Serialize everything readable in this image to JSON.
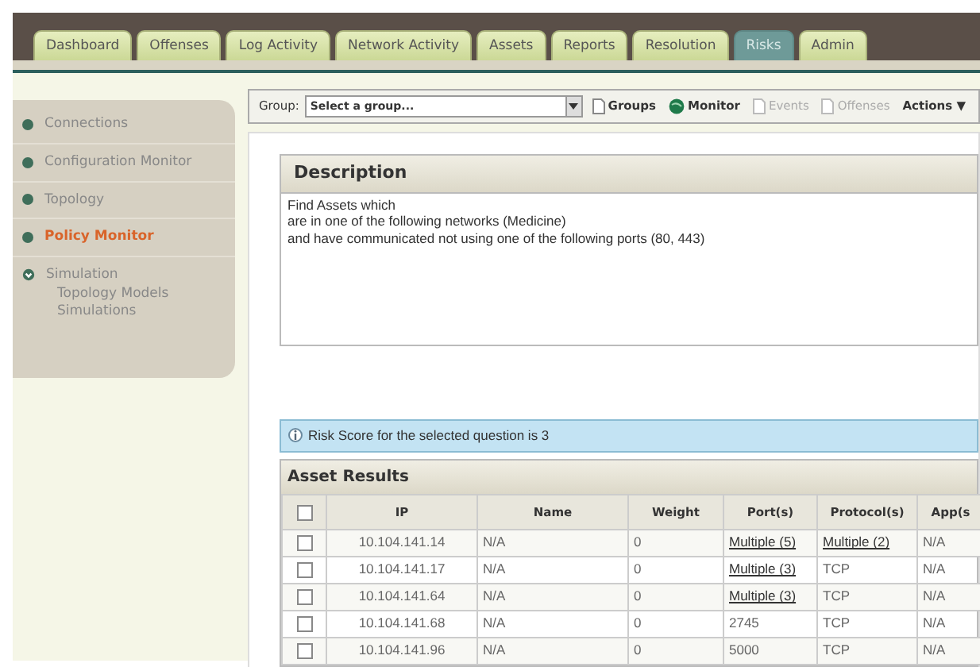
{
  "tabs": [
    {
      "label": "Dashboard",
      "selected": false
    },
    {
      "label": "Offenses",
      "selected": false
    },
    {
      "label": "Log Activity",
      "selected": false
    },
    {
      "label": "Network Activity",
      "selected": false
    },
    {
      "label": "Assets",
      "selected": false
    },
    {
      "label": "Reports",
      "selected": false
    },
    {
      "label": "Resolution",
      "selected": false
    },
    {
      "label": "Risks",
      "selected": true
    },
    {
      "label": "Admin",
      "selected": false
    }
  ],
  "sidebar": {
    "items": [
      {
        "kind": "bullet",
        "label": "Connections",
        "selected": false
      },
      {
        "kind": "bullet",
        "label": "Configuration Monitor",
        "selected": false
      },
      {
        "kind": "bullet",
        "label": "Topology",
        "selected": false
      },
      {
        "kind": "bullet",
        "label": "Policy Monitor",
        "selected": true
      },
      {
        "kind": "group",
        "label": "Simulation",
        "selected": false,
        "children": [
          {
            "label": "Topology Models"
          },
          {
            "label": "Simulations"
          }
        ]
      }
    ]
  },
  "toolbar": {
    "group_label": "Group:",
    "group_select": "Select a group...",
    "buttons": [
      {
        "kind": "page",
        "label": "Groups",
        "disabled": false
      },
      {
        "kind": "monitor",
        "label": "Monitor",
        "disabled": false
      },
      {
        "kind": "page",
        "label": "Events",
        "disabled": true
      },
      {
        "kind": "page",
        "label": "Offenses",
        "disabled": true
      },
      {
        "kind": "menu",
        "label": "Actions",
        "caret": "▼",
        "disabled": false
      }
    ]
  },
  "description": {
    "title": "Description",
    "lines": [
      "Find Assets which",
      "are in one of the following networks (Medicine)",
      "and have communicated not using one of the following ports (80, 443)"
    ]
  },
  "risk_message": "Risk Score for the selected question is 3",
  "results": {
    "title": "Asset Results",
    "columns": [
      "IP",
      "Name",
      "Weight",
      "Port(s)",
      "Protocol(s)",
      "App(s"
    ],
    "header_checked": false,
    "rows": [
      {
        "checked": false,
        "cells": [
          {
            "text": "10.104.141.14"
          },
          {
            "text": "N/A"
          },
          {
            "text": "0"
          },
          {
            "text": "Multiple (5)",
            "link": true
          },
          {
            "text": "Multiple (2)",
            "link": true
          },
          {
            "text": "N/A"
          }
        ]
      },
      {
        "checked": false,
        "cells": [
          {
            "text": "10.104.141.17"
          },
          {
            "text": "N/A"
          },
          {
            "text": "0"
          },
          {
            "text": "Multiple (3)",
            "link": true
          },
          {
            "text": "TCP"
          },
          {
            "text": "N/A"
          }
        ]
      },
      {
        "checked": false,
        "cells": [
          {
            "text": "10.104.141.64"
          },
          {
            "text": "N/A"
          },
          {
            "text": "0"
          },
          {
            "text": "Multiple (3)",
            "link": true
          },
          {
            "text": "TCP"
          },
          {
            "text": "N/A"
          }
        ]
      },
      {
        "checked": false,
        "cells": [
          {
            "text": "10.104.141.68"
          },
          {
            "text": "N/A"
          },
          {
            "text": "0"
          },
          {
            "text": "2745"
          },
          {
            "text": "TCP"
          },
          {
            "text": "N/A"
          }
        ]
      },
      {
        "checked": false,
        "cells": [
          {
            "text": "10.104.141.96"
          },
          {
            "text": "N/A"
          },
          {
            "text": "0"
          },
          {
            "text": "5000"
          },
          {
            "text": "TCP"
          },
          {
            "text": "N/A"
          }
        ]
      }
    ]
  }
}
